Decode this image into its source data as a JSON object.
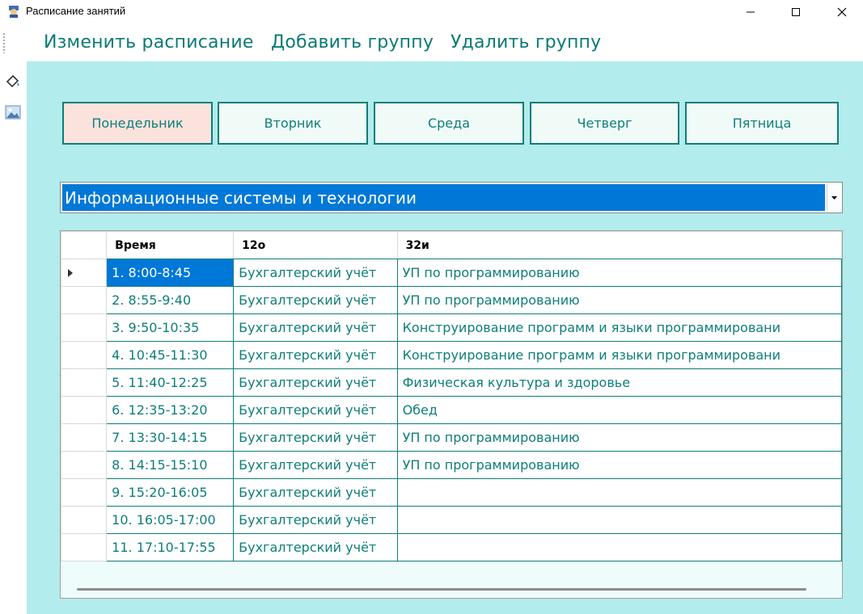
{
  "window": {
    "title": "Расписание занятий",
    "minimize_glyph": "—",
    "maximize_glyph": "☐",
    "close_glyph": "✕"
  },
  "menu": {
    "items": [
      {
        "label": "Изменить расписание"
      },
      {
        "label": "Добавить группу"
      },
      {
        "label": "Удалить группу"
      }
    ]
  },
  "toolbar": {
    "icons": [
      "paint-bucket-icon",
      "picture-icon"
    ]
  },
  "days": {
    "active": "Понедельник",
    "items": [
      {
        "label": "Понедельник"
      },
      {
        "label": "Вторник"
      },
      {
        "label": "Среда"
      },
      {
        "label": "Четверг"
      },
      {
        "label": "Пятница"
      }
    ]
  },
  "specialty_select": {
    "value": "Информационные системы и технологии"
  },
  "grid": {
    "columns": [
      "Время",
      "12о",
      "32и"
    ],
    "rows": [
      {
        "time": "1. 8:00-8:45",
        "g1": "Бухгалтерский учёт",
        "g2": "УП по программированию"
      },
      {
        "time": "2. 8:55-9:40",
        "g1": "Бухгалтерский учёт",
        "g2": "УП по программированию"
      },
      {
        "time": "3. 9:50-10:35",
        "g1": "Бухгалтерский учёт",
        "g2": "Конструирование программ и языки программировани"
      },
      {
        "time": "4. 10:45-11:30",
        "g1": "Бухгалтерский учёт",
        "g2": "Конструирование программ и языки программировани"
      },
      {
        "time": "5. 11:40-12:25",
        "g1": "Бухгалтерский учёт",
        "g2": "Физическая культура и здоровье"
      },
      {
        "time": "6. 12:35-13:20",
        "g1": "Бухгалтерский учёт",
        "g2": "Обед"
      },
      {
        "time": "7. 13:30-14:15",
        "g1": "Бухгалтерский учёт",
        "g2": "УП по программированию"
      },
      {
        "time": "8. 14:15-15:10",
        "g1": "Бухгалтерский учёт",
        "g2": "УП по программированию"
      },
      {
        "time": "9. 15:20-16:05",
        "g1": "Бухгалтерский учёт",
        "g2": ""
      },
      {
        "time": "10. 16:05-17:00",
        "g1": "Бухгалтерский учёт",
        "g2": ""
      },
      {
        "time": "11. 17:10-17:55",
        "g1": "Бухгалтерский учёт",
        "g2": ""
      }
    ]
  },
  "colors": {
    "accent": "#0e7e79",
    "panel_bg": "#b2ecec",
    "selection": "#0078d7",
    "active_day_bg": "#fbe2dd"
  }
}
